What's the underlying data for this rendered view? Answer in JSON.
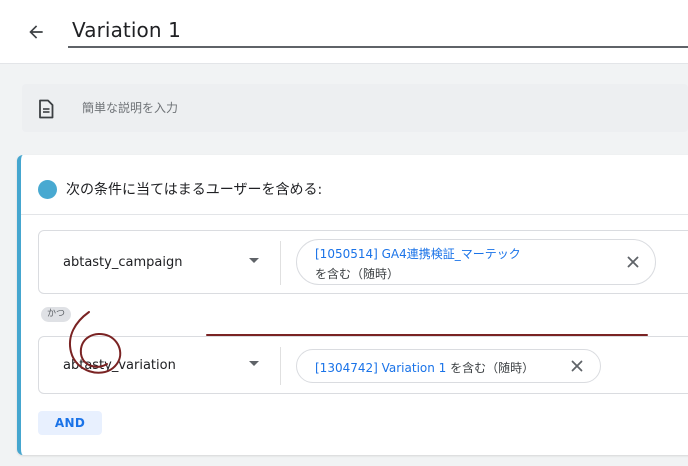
{
  "header": {
    "title_value": "Variation 1",
    "back_icon": "arrow-left-icon"
  },
  "description": {
    "icon": "document-icon",
    "placeholder": "簡単な説明を入力"
  },
  "condition_group": {
    "accent_color": "#48a9d1",
    "title": "次の条件に当てはまるユーザーを含める:",
    "conditions": [
      {
        "dimension": "abtasty_campaign",
        "value": "[1050514] GA4連携検証_マーテック",
        "operator": "を含む（随時）"
      },
      {
        "dimension": "abtasty_variation",
        "value": "[1304742] Variation 1",
        "operator": "を含む（随時）"
      }
    ],
    "connector": "かつ",
    "and_button": "AND"
  },
  "annotations": {
    "color": "#7a2323"
  }
}
